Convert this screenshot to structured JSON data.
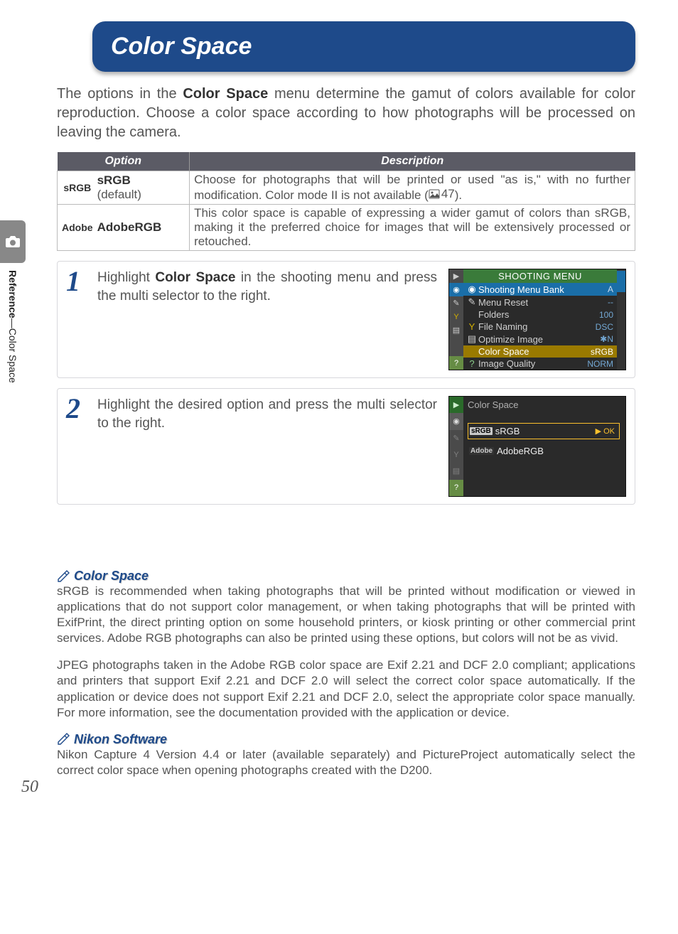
{
  "side": {
    "section": "Reference",
    "sep": "—",
    "topic": "Color Space"
  },
  "title": "Color Space",
  "intro": {
    "pre": "The options in the ",
    "bold": "Color Space",
    "post": " menu determine the gamut of colors available for color reproduction.  Choose a color space according to how photographs will be processed on leaving the camera."
  },
  "table": {
    "headers": {
      "option": "Option",
      "description": "Description"
    },
    "rows": [
      {
        "label": "sRGB",
        "name": "sRGB",
        "default": "(default)",
        "desc_pre": "Choose for photographs that will be printed or used \"as is,\" with no further modification.  Color mode II is not available (",
        "page_ref": "47",
        "desc_post": ")."
      },
      {
        "label": "Adobe",
        "name": "AdobeRGB",
        "desc": "This color space is capable of expressing a wider gamut of colors than sRGB, making it the preferred choice for images that will be extensively processed or retouched."
      }
    ]
  },
  "steps": [
    {
      "num": "1",
      "text_pre": "Highlight ",
      "bold": "Color Space",
      "text_post": " in the shooting menu and press the multi selector to the right."
    },
    {
      "num": "2",
      "text": "Highlight the desired option and press the multi selector to the right."
    }
  ],
  "lcd1": {
    "title": "SHOOTING MENU",
    "rows": [
      {
        "label": "Shooting Menu Bank",
        "val": "A",
        "sel": true
      },
      {
        "label": "Menu Reset",
        "val": "--"
      },
      {
        "label": "Folders",
        "val": "100"
      },
      {
        "label": "File Naming",
        "val": "DSC"
      },
      {
        "label": "Optimize Image",
        "val": "✱N"
      },
      {
        "label": "Color Space",
        "val": "sRGB",
        "hl": true
      },
      {
        "label": "Image Quality",
        "val": "NORM"
      }
    ]
  },
  "lcd2": {
    "title": "Color Space",
    "opts": [
      {
        "tag": "sRGB",
        "label": "sRGB",
        "ok": "▶ OK",
        "selected": true
      },
      {
        "tag": "Adobe",
        "label": "AdobeRGB"
      }
    ]
  },
  "notes": {
    "color_space": {
      "head": "Color Space",
      "p1": "sRGB is recommended when taking photographs that will be printed without modification or viewed in applications that do not support color management, or when taking photographs that will be printed with ExifPrint, the direct printing option on some household printers, or kiosk printing or other commercial print services.  Adobe RGB photographs can also be printed using these options, but colors will not be as vivid.",
      "p2": "JPEG photographs taken in the Adobe RGB color space are Exif 2.21 and DCF 2.0 compliant; applications and printers that support Exif 2.21 and DCF 2.0 will select the correct color space automatically.  If the application or device does not support Exif 2.21 and DCF 2.0, select the appropriate color space manually.  For more information, see the documentation provided with the application or device."
    },
    "nikon_software": {
      "head": "Nikon Software",
      "p1": "Nikon Capture 4 Version 4.4 or later (available separately) and PictureProject automatically select the correct color space when opening photographs created with the D200."
    }
  },
  "page_number": "50"
}
